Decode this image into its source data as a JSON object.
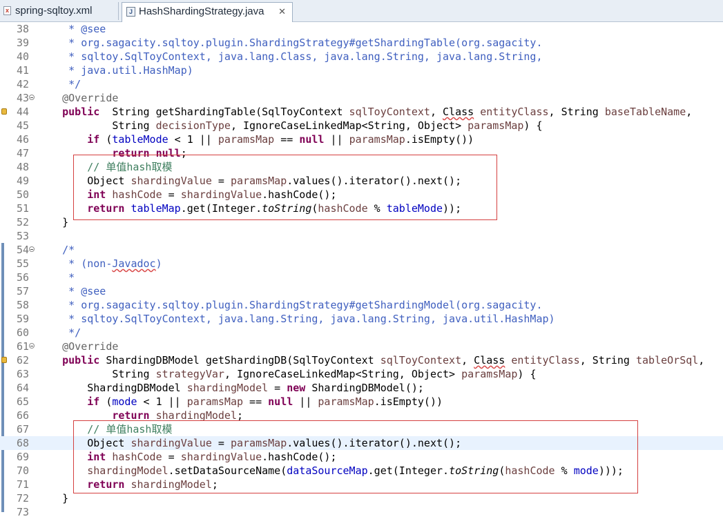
{
  "tabs": [
    {
      "label": "spring-sqltoy.xml",
      "icon": "xml-file-icon",
      "active": false
    },
    {
      "label": "HashShardingStrategy.java",
      "icon": "java-file-icon",
      "active": true
    }
  ],
  "close_glyph": "✕",
  "lines": [
    {
      "n": "38",
      "tokens": [
        [
          "cm",
          "     * @see"
        ]
      ]
    },
    {
      "n": "39",
      "tokens": [
        [
          "cm",
          "     * org.sagacity.sqltoy.plugin.ShardingStrategy#getShardingTable(org.sagacity."
        ]
      ]
    },
    {
      "n": "40",
      "tokens": [
        [
          "cm",
          "     * sqltoy.SqlToyContext, java.lang.Class, java.lang.String, java.lang.String,"
        ]
      ]
    },
    {
      "n": "41",
      "tokens": [
        [
          "cm",
          "     * java.util.HashMap)"
        ]
      ]
    },
    {
      "n": "42",
      "tokens": [
        [
          "cm",
          "     */"
        ]
      ]
    },
    {
      "n": "43",
      "fold": true,
      "tokens": [
        [
          "ann",
          "    @Override"
        ]
      ]
    },
    {
      "n": "44",
      "marker": true,
      "tokens": [
        [
          "kw",
          "    public"
        ],
        [
          "",
          "  String getShardingTable(SqlToyContext "
        ],
        [
          "var",
          "sqlToyContext"
        ],
        [
          "",
          ", "
        ],
        [
          "sq",
          "Class"
        ],
        [
          "var",
          " entityClass"
        ],
        [
          "",
          ", String "
        ],
        [
          "var",
          "baseTableName"
        ],
        [
          "",
          ","
        ]
      ]
    },
    {
      "n": "45",
      "tokens": [
        [
          "",
          "            String "
        ],
        [
          "var",
          "decisionType"
        ],
        [
          "",
          ", IgnoreCaseLinkedMap<String, Object> "
        ],
        [
          "var",
          "paramsMap"
        ],
        [
          "",
          ") {"
        ]
      ]
    },
    {
      "n": "46",
      "tokens": [
        [
          "kw",
          "        if"
        ],
        [
          "",
          " ("
        ],
        [
          "fld",
          "tableMode"
        ],
        [
          "",
          " < 1 || "
        ],
        [
          "var",
          "paramsMap"
        ],
        [
          "",
          " == "
        ],
        [
          "kw",
          "null"
        ],
        [
          "",
          " || "
        ],
        [
          "var",
          "paramsMap"
        ],
        [
          "",
          ".isEmpty())"
        ]
      ]
    },
    {
      "n": "47",
      "tokens": [
        [
          "kw",
          "            return"
        ],
        [
          "",
          " "
        ],
        [
          "kw",
          "null"
        ],
        [
          "",
          ";"
        ]
      ]
    },
    {
      "n": "48",
      "tokens": [
        [
          "lc",
          "        // 单值hash取模"
        ]
      ]
    },
    {
      "n": "49",
      "tokens": [
        [
          "",
          "        Object "
        ],
        [
          "var",
          "shardingValue"
        ],
        [
          "",
          " = "
        ],
        [
          "var",
          "paramsMap"
        ],
        [
          "",
          ".values().iterator().next();"
        ]
      ]
    },
    {
      "n": "50",
      "tokens": [
        [
          "kw",
          "        int"
        ],
        [
          "var",
          " hashCode"
        ],
        [
          "",
          " = "
        ],
        [
          "var",
          "shardingValue"
        ],
        [
          "",
          ".hashCode();"
        ]
      ]
    },
    {
      "n": "51",
      "tokens": [
        [
          "kw",
          "        return"
        ],
        [
          "",
          " "
        ],
        [
          "fld",
          "tableMap"
        ],
        [
          "",
          ".get(Integer."
        ],
        [
          "st",
          "toString"
        ],
        [
          "",
          "("
        ],
        [
          "var",
          "hashCode"
        ],
        [
          "",
          " % "
        ],
        [
          "fld",
          "tableMode"
        ],
        [
          "",
          "));"
        ]
      ]
    },
    {
      "n": "52",
      "tokens": [
        [
          "",
          "    }"
        ]
      ]
    },
    {
      "n": "53",
      "tokens": [
        [
          "",
          ""
        ]
      ]
    },
    {
      "n": "54",
      "fold": true,
      "tokens": [
        [
          "cm",
          "    /*"
        ]
      ]
    },
    {
      "n": "55",
      "tokens": [
        [
          "cm",
          "     * (non-"
        ],
        [
          "cm sq",
          "Javadoc"
        ],
        [
          "cm",
          ")"
        ]
      ]
    },
    {
      "n": "56",
      "tokens": [
        [
          "cm",
          "     *"
        ]
      ]
    },
    {
      "n": "57",
      "tokens": [
        [
          "cm",
          "     * @see"
        ]
      ]
    },
    {
      "n": "58",
      "tokens": [
        [
          "cm",
          "     * org.sagacity.sqltoy.plugin.ShardingStrategy#getShardingModel(org.sagacity."
        ]
      ]
    },
    {
      "n": "59",
      "tokens": [
        [
          "cm",
          "     * sqltoy.SqlToyContext, java.lang.String, java.lang.String, java.util.HashMap)"
        ]
      ]
    },
    {
      "n": "60",
      "tokens": [
        [
          "cm",
          "     */"
        ]
      ]
    },
    {
      "n": "61",
      "fold": true,
      "tokens": [
        [
          "ann",
          "    @Override"
        ]
      ]
    },
    {
      "n": "62",
      "marker": true,
      "tokens": [
        [
          "kw",
          "    public"
        ],
        [
          "",
          " ShardingDBModel getShardingDB(SqlToyContext "
        ],
        [
          "var",
          "sqlToyContext"
        ],
        [
          "",
          ", "
        ],
        [
          "sq",
          "Class"
        ],
        [
          "var",
          " entityClass"
        ],
        [
          "",
          ", String "
        ],
        [
          "var",
          "tableOrSql"
        ],
        [
          "",
          ","
        ]
      ]
    },
    {
      "n": "63",
      "tokens": [
        [
          "",
          "            String "
        ],
        [
          "var",
          "strategyVar"
        ],
        [
          "",
          ", IgnoreCaseLinkedMap<String, Object> "
        ],
        [
          "var",
          "paramsMap"
        ],
        [
          "",
          ") {"
        ]
      ]
    },
    {
      "n": "64",
      "tokens": [
        [
          "",
          "        ShardingDBModel "
        ],
        [
          "var",
          "shardingModel"
        ],
        [
          "",
          " = "
        ],
        [
          "kw",
          "new"
        ],
        [
          "",
          " ShardingDBModel();"
        ]
      ]
    },
    {
      "n": "65",
      "tokens": [
        [
          "kw",
          "        if"
        ],
        [
          "",
          " ("
        ],
        [
          "fld",
          "mode"
        ],
        [
          "",
          " < 1 || "
        ],
        [
          "var",
          "paramsMap"
        ],
        [
          "",
          " == "
        ],
        [
          "kw",
          "null"
        ],
        [
          "",
          " || "
        ],
        [
          "var",
          "paramsMap"
        ],
        [
          "",
          ".isEmpty())"
        ]
      ]
    },
    {
      "n": "66",
      "tokens": [
        [
          "kw",
          "            return"
        ],
        [
          "var",
          " shardingModel"
        ],
        [
          "",
          ";"
        ]
      ]
    },
    {
      "n": "67",
      "tokens": [
        [
          "lc",
          "        // 单值hash取模"
        ]
      ]
    },
    {
      "n": "68",
      "current": true,
      "tokens": [
        [
          "",
          "        Object "
        ],
        [
          "var",
          "shardingValue"
        ],
        [
          "",
          " = "
        ],
        [
          "var",
          "paramsMap"
        ],
        [
          "",
          ".values().iterator().next();"
        ]
      ]
    },
    {
      "n": "69",
      "tokens": [
        [
          "kw",
          "        int"
        ],
        [
          "var",
          " hashCode"
        ],
        [
          "",
          " = "
        ],
        [
          "var",
          "shardingValue"
        ],
        [
          "",
          ".hashCode();"
        ]
      ]
    },
    {
      "n": "70",
      "tokens": [
        [
          "var",
          "        shardingModel"
        ],
        [
          "",
          ".setDataSourceName("
        ],
        [
          "fld",
          "dataSourceMap"
        ],
        [
          "",
          ".get(Integer."
        ],
        [
          "st",
          "toString"
        ],
        [
          "",
          "("
        ],
        [
          "var",
          "hashCode"
        ],
        [
          "",
          " % "
        ],
        [
          "fld",
          "mode"
        ],
        [
          "",
          ")));"
        ]
      ]
    },
    {
      "n": "71",
      "tokens": [
        [
          "kw",
          "        return"
        ],
        [
          "var",
          " shardingModel"
        ],
        [
          "",
          ";"
        ]
      ]
    },
    {
      "n": "72",
      "tokens": [
        [
          "",
          "    }"
        ]
      ]
    },
    {
      "n": "73",
      "tokens": [
        [
          "",
          ""
        ]
      ]
    }
  ]
}
